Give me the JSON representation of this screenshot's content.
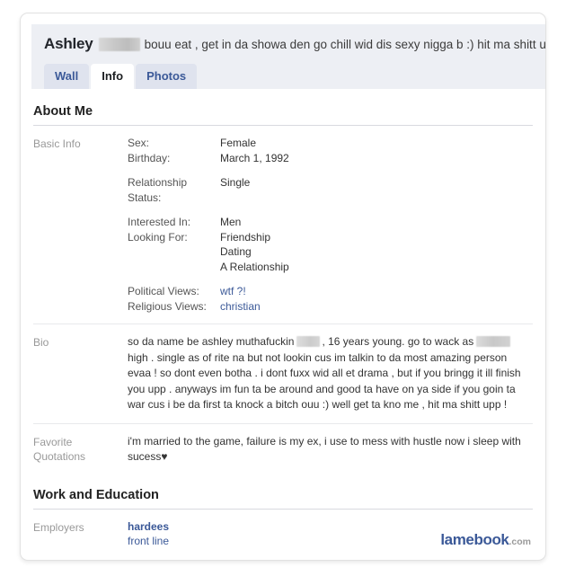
{
  "profile": {
    "name": "Ashley",
    "name_redacted": true,
    "status_text": "bouu eat , get in da showa den go chill wid dis sexy nigga b :) hit ma shitt uppp !"
  },
  "tabs": [
    {
      "label": "Wall",
      "active": false
    },
    {
      "label": "Info",
      "active": true
    },
    {
      "label": "Photos",
      "active": false
    }
  ],
  "sections": {
    "about_me": {
      "title": "About Me",
      "basic_info": {
        "label": "Basic Info",
        "group1": [
          {
            "key": "Sex:",
            "value": "Female"
          },
          {
            "key": "Birthday:",
            "value": "March 1, 1992"
          }
        ],
        "group2": [
          {
            "key": "Relationship Status:",
            "value": "Single"
          }
        ],
        "group3": [
          {
            "key": "Interested In:",
            "value": "Men"
          },
          {
            "key": "Looking For:",
            "value": "Friendship"
          }
        ],
        "group3_extra": [
          "Dating",
          "A Relationship"
        ],
        "group4": [
          {
            "key": "Political Views:",
            "value": "wtf ?!",
            "link": true
          },
          {
            "key": "Religious Views:",
            "value": "christian",
            "link": true
          }
        ]
      },
      "bio": {
        "label": "Bio",
        "part1": "so da name be ashley muthafuckin",
        "part2": ", 16 years young. go to wack as",
        "part3": "high . single as of rite na but not lookin cus im talkin to da most amazing person evaa ! so dont even botha . i dont fuxx wid all et drama , but if you bringg it ill finish you upp . anyways im fun ta be around and good ta have on ya side if you goin ta war cus i be da first ta knock a bitch ouu :) well get ta kno me , hit ma shitt upp !"
      },
      "favorite_quotations": {
        "label": "Favorite Quotations",
        "label_line1": "Favorite",
        "label_line2": "Quotations",
        "value": "i'm married to the game, failure is my ex, i use to mess with hustle now i sleep with sucess",
        "heart": "♥"
      }
    },
    "work_education": {
      "title": "Work and Education",
      "employers": {
        "label": "Employers",
        "name": "hardees",
        "role": "front line"
      }
    }
  },
  "watermark": {
    "brand": "lamebook",
    "tld": ".com"
  },
  "colors": {
    "link": "#3b5998",
    "header_band": "#edeff4",
    "tab_inactive": "#dfe3ee",
    "label_gray": "#999999"
  }
}
